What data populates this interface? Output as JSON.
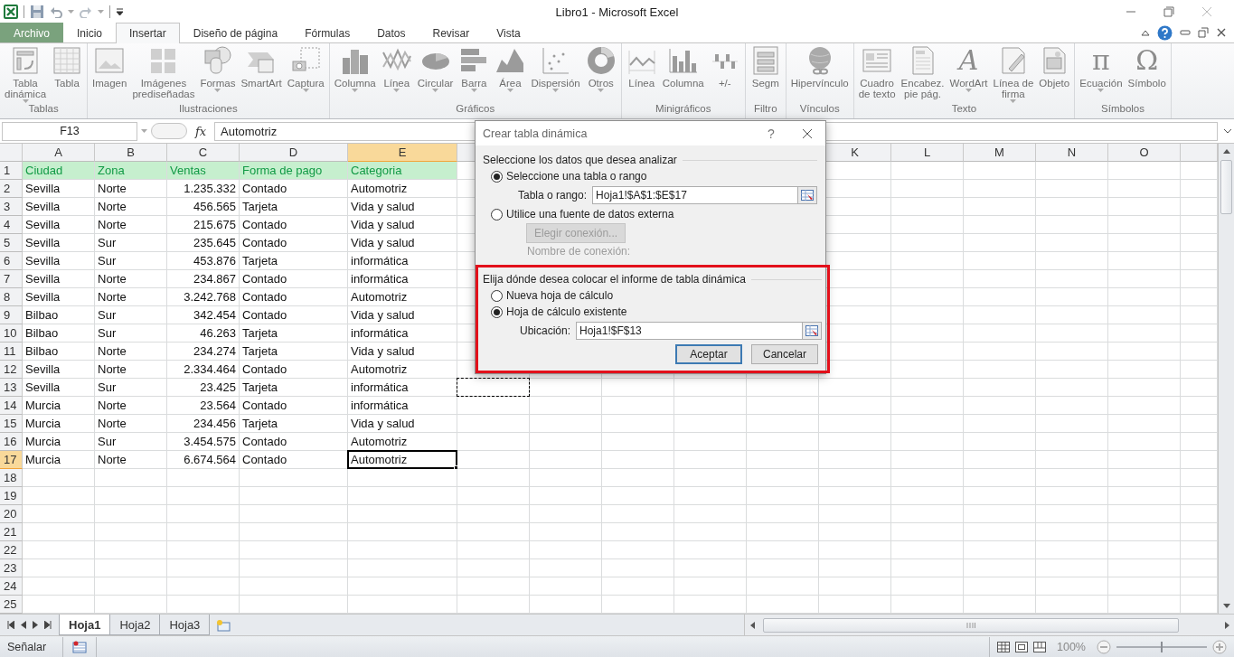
{
  "title_bar": {
    "title": "Libro1  -  Microsoft Excel"
  },
  "tabs": [
    {
      "label": "Archivo",
      "kind": "file",
      "selected": false
    },
    {
      "label": "Inicio",
      "kind": "tab",
      "selected": false
    },
    {
      "label": "Insertar",
      "kind": "tab",
      "selected": true
    },
    {
      "label": "Diseño de página",
      "kind": "tab",
      "selected": false
    },
    {
      "label": "Fórmulas",
      "kind": "tab",
      "selected": false
    },
    {
      "label": "Datos",
      "kind": "tab",
      "selected": false
    },
    {
      "label": "Revisar",
      "kind": "tab",
      "selected": false
    },
    {
      "label": "Vista",
      "kind": "tab",
      "selected": false
    }
  ],
  "ribbon_groups": [
    {
      "label": "Tablas",
      "buttons": [
        {
          "label": "Tabla\ndinámica",
          "dropdown": true
        },
        {
          "label": "Tabla",
          "dropdown": false
        }
      ]
    },
    {
      "label": "Ilustraciones",
      "buttons": [
        {
          "label": "Imagen",
          "dropdown": false
        },
        {
          "label": "Imágenes\nprediseñadas",
          "dropdown": false
        },
        {
          "label": "Formas",
          "dropdown": true
        },
        {
          "label": "SmartArt",
          "dropdown": false
        },
        {
          "label": "Captura",
          "dropdown": true
        }
      ]
    },
    {
      "label": "Gráficos",
      "buttons": [
        {
          "label": "Columna",
          "dropdown": true
        },
        {
          "label": "Línea",
          "dropdown": true
        },
        {
          "label": "Circular",
          "dropdown": true
        },
        {
          "label": "Barra",
          "dropdown": true
        },
        {
          "label": "Área",
          "dropdown": true
        },
        {
          "label": "Dispersión",
          "dropdown": true
        },
        {
          "label": "Otros",
          "dropdown": true
        }
      ]
    },
    {
      "label": "Minigráficos",
      "buttons": [
        {
          "label": "Línea",
          "dropdown": false
        },
        {
          "label": "Columna",
          "dropdown": false
        },
        {
          "label": "+/-",
          "dropdown": false
        }
      ]
    },
    {
      "label": "Filtro",
      "buttons": [
        {
          "label": "Segm",
          "dropdown": false
        }
      ]
    },
    {
      "label": "Vínculos",
      "buttons": [
        {
          "label": "Hipervínculo",
          "dropdown": false
        }
      ]
    },
    {
      "label": "Texto",
      "buttons": [
        {
          "label": "Cuadro\nde texto",
          "dropdown": false
        },
        {
          "label": "Encabez.\npie pág.",
          "dropdown": false
        },
        {
          "label": "WordArt",
          "dropdown": true,
          "glyph": "A"
        },
        {
          "label": "Línea de\nfirma",
          "dropdown": true
        },
        {
          "label": "Objeto",
          "dropdown": false
        }
      ]
    },
    {
      "label": "Símbolos",
      "buttons": [
        {
          "label": "Ecuación",
          "dropdown": true,
          "glyph": "π"
        },
        {
          "label": "Símbolo",
          "dropdown": false,
          "glyph": "Ω"
        }
      ]
    }
  ],
  "formula_bar": {
    "name_box": "F13",
    "function_label": "fx",
    "value": "Automotriz"
  },
  "columns": [
    {
      "label": "A",
      "selected": false
    },
    {
      "label": "B",
      "selected": false
    },
    {
      "label": "C",
      "selected": false
    },
    {
      "label": "D",
      "selected": false
    },
    {
      "label": "E",
      "selected": true
    }
  ],
  "columns_right": [
    "K",
    "L",
    "M",
    "N",
    "O"
  ],
  "rows": [
    {
      "number": "1",
      "kind": "header",
      "selected": false,
      "marked": false,
      "cells": [
        "Ciudad",
        "Zona",
        "Ventas",
        "Forma de pago",
        "Categoria"
      ]
    },
    {
      "number": "2",
      "kind": "data",
      "selected": false,
      "marked": false,
      "cells": [
        "Sevilla",
        "Norte",
        "1.235.332",
        "Contado",
        "Automotriz"
      ]
    },
    {
      "number": "3",
      "kind": "data",
      "selected": false,
      "marked": false,
      "cells": [
        "Sevilla",
        "Norte",
        "456.565",
        "Tarjeta",
        "Vida y salud"
      ]
    },
    {
      "number": "4",
      "kind": "data",
      "selected": false,
      "marked": false,
      "cells": [
        "Sevilla",
        "Norte",
        "215.675",
        "Contado",
        "Vida y salud"
      ]
    },
    {
      "number": "5",
      "kind": "data",
      "selected": false,
      "marked": false,
      "cells": [
        "Sevilla",
        "Sur",
        "235.645",
        "Contado",
        "Vida y salud"
      ]
    },
    {
      "number": "6",
      "kind": "data",
      "selected": false,
      "marked": false,
      "cells": [
        "Sevilla",
        "Sur",
        "453.876",
        "Tarjeta",
        "informática"
      ]
    },
    {
      "number": "7",
      "kind": "data",
      "selected": false,
      "marked": false,
      "cells": [
        "Sevilla",
        "Norte",
        "234.867",
        "Contado",
        "informática"
      ]
    },
    {
      "number": "8",
      "kind": "data",
      "selected": false,
      "marked": false,
      "cells": [
        "Sevilla",
        "Norte",
        "3.242.768",
        "Contado",
        "Automotriz"
      ]
    },
    {
      "number": "9",
      "kind": "data",
      "selected": false,
      "marked": false,
      "cells": [
        "Bilbao",
        "Sur",
        "342.454",
        "Contado",
        "Vida y salud"
      ]
    },
    {
      "number": "10",
      "kind": "data",
      "selected": false,
      "marked": false,
      "cells": [
        "Bilbao",
        "Sur",
        "46.263",
        "Tarjeta",
        "informática"
      ]
    },
    {
      "number": "11",
      "kind": "data",
      "selected": false,
      "marked": false,
      "cells": [
        "Bilbao",
        "Norte",
        "234.274",
        "Tarjeta",
        "Vida y salud"
      ]
    },
    {
      "number": "12",
      "kind": "data",
      "selected": false,
      "marked": false,
      "cells": [
        "Sevilla",
        "Norte",
        "2.334.464",
        "Contado",
        "Automotriz"
      ]
    },
    {
      "number": "13",
      "kind": "data",
      "selected": false,
      "marked": true,
      "cells": [
        "Sevilla",
        "Sur",
        "23.425",
        "Tarjeta",
        "informática"
      ]
    },
    {
      "number": "14",
      "kind": "data",
      "selected": false,
      "marked": false,
      "cells": [
        "Murcia",
        "Norte",
        "23.564",
        "Contado",
        "informática"
      ]
    },
    {
      "number": "15",
      "kind": "data",
      "selected": false,
      "marked": false,
      "cells": [
        "Murcia",
        "Norte",
        "234.456",
        "Tarjeta",
        "Vida y salud"
      ]
    },
    {
      "number": "16",
      "kind": "data",
      "selected": false,
      "marked": false,
      "cells": [
        "Murcia",
        "Sur",
        "3.454.575",
        "Contado",
        "Automotriz"
      ]
    },
    {
      "number": "17",
      "kind": "data",
      "selected": true,
      "marked": false,
      "cells": [
        "Murcia",
        "Norte",
        "6.674.564",
        "Contado",
        "Automotriz"
      ]
    }
  ],
  "empty_rows": [
    "18",
    "19",
    "20",
    "21",
    "22",
    "23",
    "24",
    "25"
  ],
  "sheet_tabs": [
    {
      "label": "Hoja1",
      "selected": true
    },
    {
      "label": "Hoja2",
      "selected": false
    },
    {
      "label": "Hoja3",
      "selected": false
    }
  ],
  "status_bar": {
    "mode": "Señalar",
    "zoom": {
      "reading": "100%",
      "level": 0.5
    }
  },
  "dialog": {
    "title": "Crear tabla dinámica",
    "help": "?",
    "source": {
      "heading": "Seleccione los datos que desea analizar",
      "options": [
        {
          "label": "Seleccione una tabla o rango",
          "selected": true
        },
        {
          "label": "Utilice una fuente de datos externa",
          "selected": false
        }
      ],
      "range_label": "Tabla o rango:",
      "range_value": "Hoja1!$A$1:$E$17",
      "connection_button": {
        "label": "Elegir conexión...",
        "disabled": true
      },
      "connection_label": "Nombre de conexión:"
    },
    "destination": {
      "heading": "Elija dónde desea colocar el informe de tabla dinámica",
      "highlighted": true,
      "options": [
        {
          "label": "Nueva hoja de cálculo",
          "selected": false
        },
        {
          "label": "Hoja de cálculo existente",
          "selected": true
        }
      ],
      "location_label": "Ubicación:",
      "location_value": "Hoja1!$F$13"
    },
    "buttons": [
      {
        "label": "Aceptar",
        "default": true
      },
      {
        "label": "Cancelar",
        "default": false
      }
    ]
  }
}
